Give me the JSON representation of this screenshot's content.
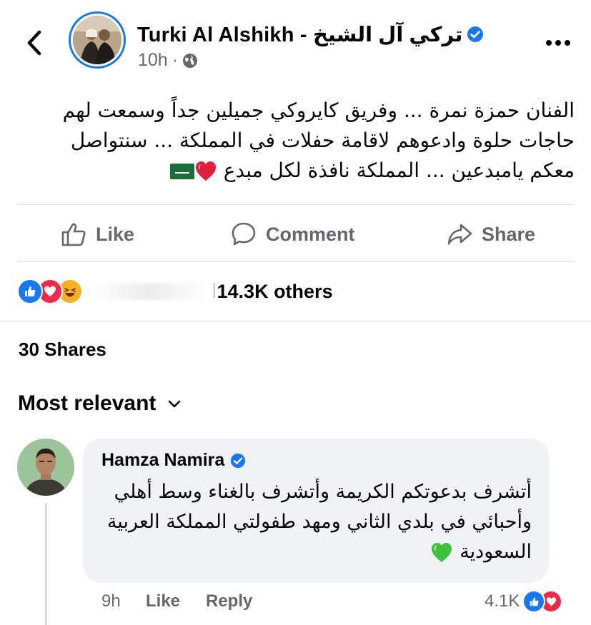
{
  "post": {
    "author": "Turki Al Alshikh - تركي آل الشيخ",
    "time": "10h",
    "separator": "·",
    "audience_icon": "globe-icon",
    "text_lines": [
      "الفنان حمزة نمرة ... وفريق كايروكي جميلين جداً وسمعت لهم",
      "حاجات حلوة وادعوهم لاقامة حفلات في المملكة ... سنتواصل",
      "معكم يامبدعين ... المملكة نافذة لكل مبدع"
    ],
    "text_emojis": [
      "red-heart-emoji",
      "saudi-flag-emoji"
    ]
  },
  "actions": {
    "like": "Like",
    "comment": "Comment",
    "share": "Share"
  },
  "reactions": {
    "types": [
      "like",
      "love",
      "haha"
    ],
    "summary": "14.3K others",
    "hidden_prefix": "ا"
  },
  "shares": "30 Shares",
  "sort": {
    "label": "Most relevant"
  },
  "comment": {
    "author": "Hamza Namira",
    "text_lines": [
      "أتشرف بدعوتكم الكريمة وأتشرف بالغناء وسط أهلي",
      "وأحبائي في بلدي الثاني ومهد طفولتي المملكة العربية",
      "السعودية"
    ],
    "emoji": "green-heart-emoji",
    "time": "9h",
    "like": "Like",
    "reply": "Reply",
    "reaction_count": "4.1K"
  },
  "colors": {
    "accent": "#1877f2",
    "secondary_text": "#65676b",
    "bubble": "#f0f2f5",
    "love": "#f02849",
    "haha": "#f7b125",
    "green_heart": "#3ec23e"
  }
}
